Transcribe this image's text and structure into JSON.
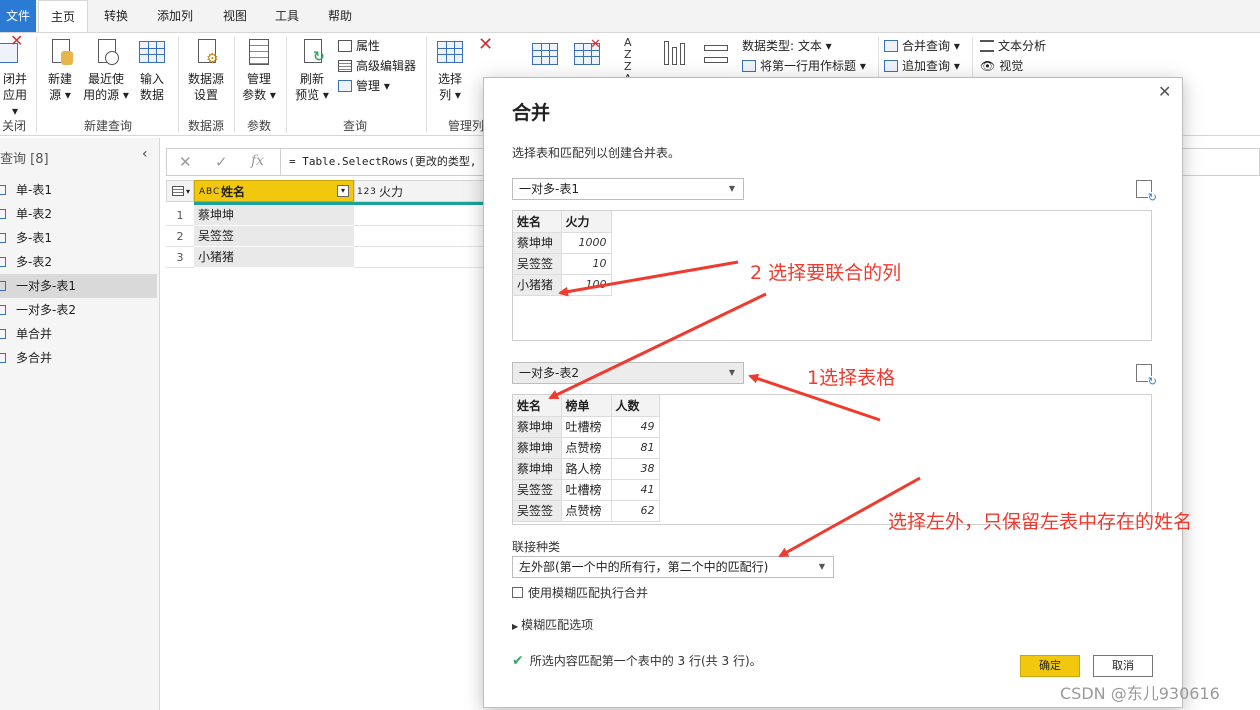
{
  "ribbon_tabs": [
    "文件",
    "主页",
    "转换",
    "添加列",
    "视图",
    "工具",
    "帮助"
  ],
  "ribbon": {
    "close_apply": "闭并\n应用 ▾",
    "new_source": "新建\n源 ▾",
    "recent_sources": "最近使\n用的源 ▾",
    "enter_data": "输入\n数据",
    "data_source_settings": "数据源\n设置",
    "manage_params": "管理\n参数 ▾",
    "refresh_preview": "刷新\n预览 ▾",
    "properties": "属性",
    "advanced_editor": "高级编辑器",
    "manage": "管理 ▾",
    "choose_columns": "选择\n列 ▾",
    "data_type": "数据类型: 文本 ▾",
    "first_row_header": "将第一行用作标题 ▾",
    "merge_queries": "合并查询 ▾",
    "append_queries": "追加查询 ▾",
    "text_analytics": "文本分析",
    "vision": "视觉",
    "groups": {
      "close": "关闭",
      "new_query": "新建查询",
      "data_source": "数据源",
      "params": "参数",
      "query": "查询",
      "manage_cols": "管理列"
    }
  },
  "formula": "= Table.SelectRows(更改的类型,",
  "query_pane": {
    "title": "查询 [8]",
    "items": [
      {
        "label": "单-表1",
        "selected": false
      },
      {
        "label": "单-表2",
        "selected": false
      },
      {
        "label": "多-表1",
        "selected": false
      },
      {
        "label": "多-表2",
        "selected": false
      },
      {
        "label": "一对多-表1",
        "selected": true
      },
      {
        "label": "一对多-表2",
        "selected": false
      },
      {
        "label": "单合并",
        "selected": false
      },
      {
        "label": "多合并",
        "selected": false
      }
    ]
  },
  "grid": {
    "col_name": "姓名",
    "col_name_type": "A B C",
    "col_hp": "火力",
    "col_hp_type": "1 2 3",
    "rows": [
      {
        "n": "1",
        "name": "蔡坤坤"
      },
      {
        "n": "2",
        "name": "吴签签"
      },
      {
        "n": "3",
        "name": "小猪猪"
      }
    ]
  },
  "modal": {
    "title": "合并",
    "description": "选择表和匹配列以创建合并表。",
    "table1_select": "一对多-表1",
    "table1": {
      "headers": [
        "姓名",
        "火力"
      ],
      "rows": [
        [
          "蔡坤坤",
          "1000"
        ],
        [
          "吴签签",
          "10"
        ],
        [
          "小猪猪",
          "100"
        ]
      ]
    },
    "table2_select": "一对多-表2",
    "table2": {
      "headers": [
        "姓名",
        "榜单",
        "人数"
      ],
      "rows": [
        [
          "蔡坤坤",
          "吐槽榜",
          "49"
        ],
        [
          "蔡坤坤",
          "点赞榜",
          "81"
        ],
        [
          "蔡坤坤",
          "路人榜",
          "38"
        ],
        [
          "吴签签",
          "吐槽榜",
          "41"
        ],
        [
          "吴签签",
          "点赞榜",
          "62"
        ]
      ]
    },
    "join_kind_label": "联接种类",
    "join_kind_value": "左外部(第一个中的所有行，第二个中的匹配行)",
    "fuzzy_checkbox": "使用模糊匹配执行合并",
    "fuzzy_options": "模糊匹配选项",
    "status": "所选内容匹配第一个表中的 3 行(共 3 行)。",
    "ok": "确定",
    "cancel": "取消"
  },
  "annotations": {
    "step2": "2 选择要联合的列",
    "step1": "1选择表格",
    "step3": "选择左外，只保留左表中存在的姓名",
    "color": "#f03a2e"
  },
  "watermark": "CSDN @东儿930616",
  "colors": {
    "accent": "#f2c80f",
    "file_tab": "#2b7bd4",
    "annotation": "#f03a2e"
  }
}
